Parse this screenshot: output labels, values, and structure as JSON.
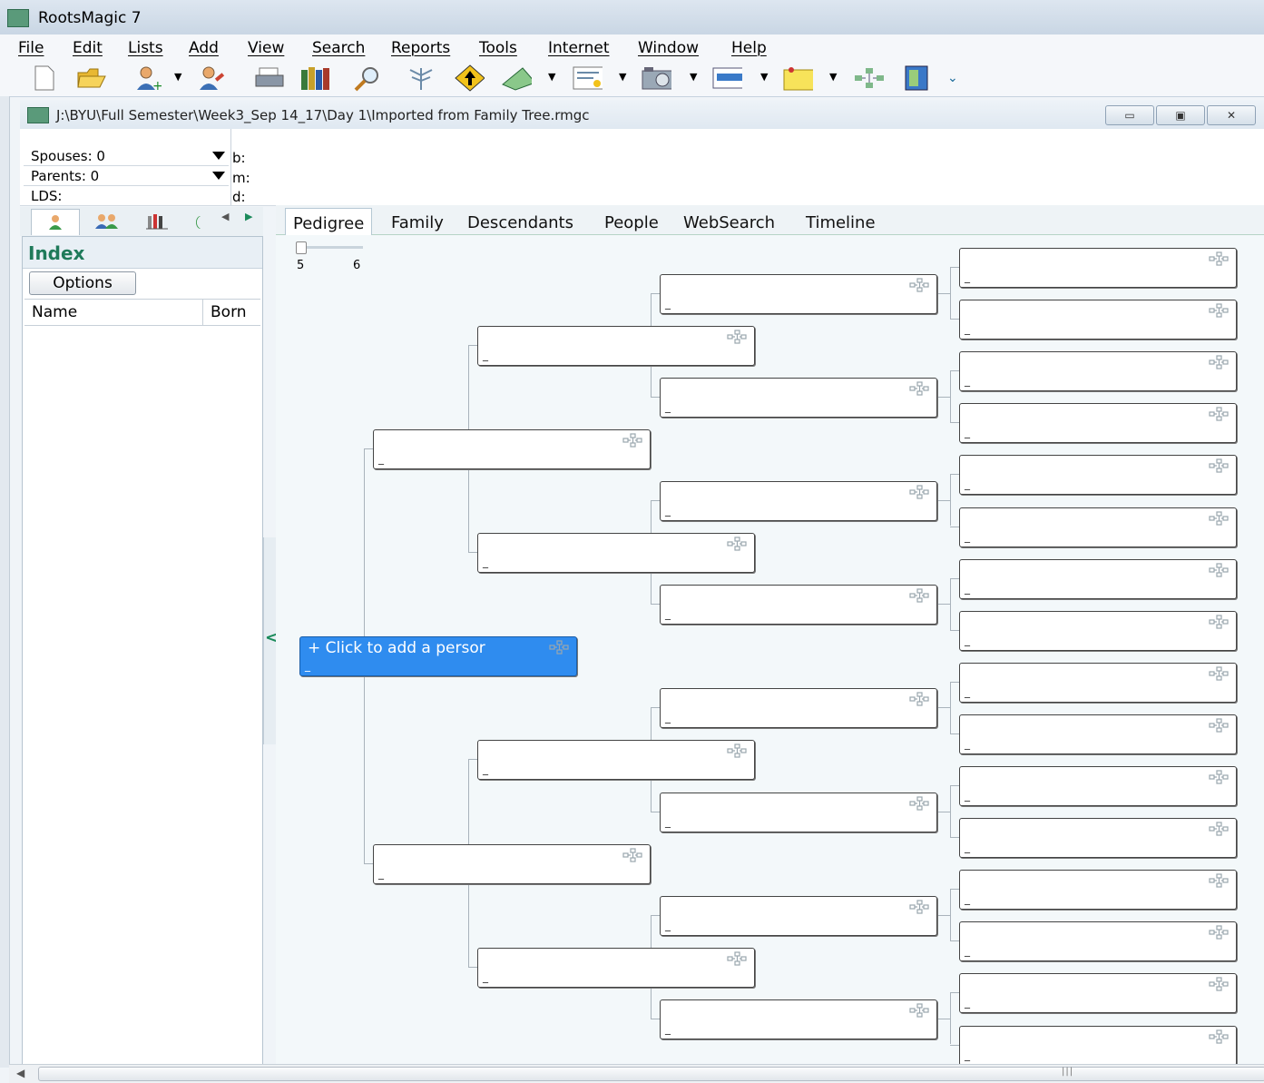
{
  "app": {
    "title": "RootsMagic 7"
  },
  "menu": [
    "File",
    "Edit",
    "Lists",
    "Add",
    "View",
    "Search",
    "Reports",
    "Tools",
    "Internet",
    "Window",
    "Help"
  ],
  "document": {
    "path": "J:\\BYU\\Full Semester\\Week3_Sep 14_17\\Day 1\\Imported from Family Tree.rmgc"
  },
  "info": {
    "spouses": "Spouses: 0",
    "parents": "Parents: 0",
    "lds": "LDS:",
    "birth": "b:",
    "marriage": "m:",
    "death": "d:"
  },
  "sidebar": {
    "title": "Index",
    "options_label": "Options",
    "columns": [
      "Name",
      "Born"
    ]
  },
  "main_tabs": [
    "Pedigree",
    "Family",
    "Descendants",
    "People",
    "WebSearch",
    "Timeline"
  ],
  "active_tab": "Pedigree",
  "generations": {
    "min": "5",
    "max": "6"
  },
  "pedigree": {
    "primary_label": "+ Click to add a persor",
    "empty_dash": "_"
  },
  "colors": {
    "accent": "#2f8cef",
    "index_title": "#1f7a5a"
  },
  "icons": [
    "new-file-icon",
    "open-folder-icon",
    "add-person-icon",
    "edit-person-icon",
    "print-icon",
    "books-icon",
    "search-icon",
    "tree-icon",
    "navigate-icon",
    "publish-icon",
    "certificate-icon",
    "camera-icon",
    "screen-icon",
    "note-icon",
    "family-tree-icon",
    "exit-icon"
  ]
}
